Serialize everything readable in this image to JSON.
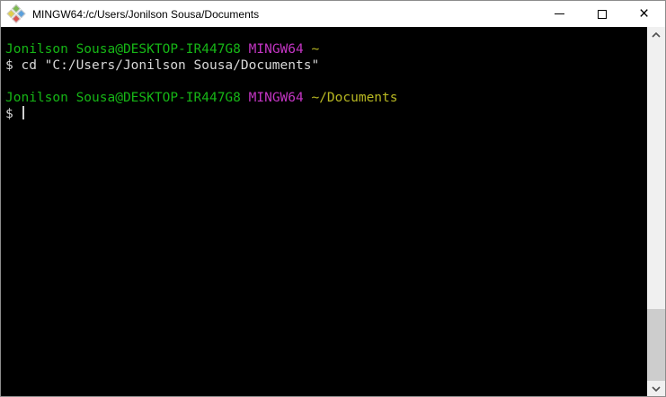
{
  "window": {
    "title": "MINGW64:/c/Users/Jonilson Sousa/Documents"
  },
  "titlebar": {
    "app_icon": "msys2-diamond-icon",
    "minimize_icon": "minimize-bar",
    "maximize_icon": "maximize-square",
    "close_glyph": "×"
  },
  "scrollbar": {
    "up_icon": "chevron-up",
    "down_icon": "chevron-down",
    "thumb_position": "bottom"
  },
  "terminal": {
    "colors": {
      "green": "#16b616",
      "magenta": "#c435c4",
      "yellow": "#b8b822",
      "fg": "#d8d8d8",
      "bg": "#000000"
    },
    "lines": [
      {
        "segments": [
          {
            "text": "Jonilson Sousa@DESKTOP-IR447G8 ",
            "color": "green"
          },
          {
            "text": "MINGW64 ",
            "color": "magenta"
          },
          {
            "text": "~",
            "color": "yellow"
          }
        ]
      },
      {
        "segments": [
          {
            "text": "$ cd \"C:/Users/Jonilson Sousa/Documents\"",
            "color": "fg"
          }
        ]
      },
      {
        "segments": []
      },
      {
        "segments": [
          {
            "text": "Jonilson Sousa@DESKTOP-IR447G8 ",
            "color": "green"
          },
          {
            "text": "MINGW64 ",
            "color": "magenta"
          },
          {
            "text": "~/Documents",
            "color": "yellow"
          }
        ]
      },
      {
        "segments": [
          {
            "text": "$ ",
            "color": "fg"
          }
        ],
        "cursor": true
      }
    ]
  }
}
